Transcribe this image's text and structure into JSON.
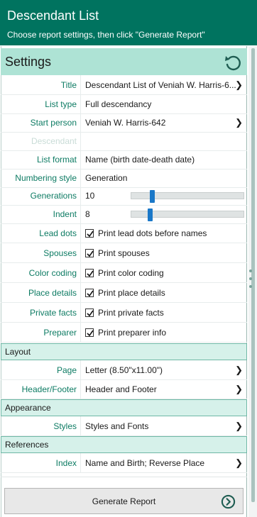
{
  "header": {
    "title": "Descendant List",
    "subtitle": "Choose report settings, then click \"Generate Report\""
  },
  "settings": {
    "label": "Settings",
    "reset_icon": "reset-icon"
  },
  "rows": {
    "title": {
      "label": "Title",
      "value": "Descendant List of Veniah W. Harris-6..."
    },
    "list_type": {
      "label": "List type",
      "value": "Full descendancy"
    },
    "start_person": {
      "label": "Start person",
      "value": "Veniah W. Harris-642"
    },
    "descendant": {
      "label": "Descendant",
      "value": ""
    },
    "list_format": {
      "label": "List format",
      "value": "Name (birth date-death date)"
    },
    "numbering_style": {
      "label": "Numbering style",
      "value": "Generation"
    },
    "generations": {
      "label": "Generations",
      "value": "10",
      "slider_fraction": 0.17
    },
    "indent": {
      "label": "Indent",
      "value": "8",
      "slider_fraction": 0.15
    },
    "lead_dots": {
      "label": "Lead dots",
      "value": "Print lead dots before names",
      "checked": true
    },
    "spouses": {
      "label": "Spouses",
      "value": "Print spouses",
      "checked": true
    },
    "color_coding": {
      "label": "Color coding",
      "value": "Print color coding",
      "checked": true
    },
    "place_details": {
      "label": "Place details",
      "value": "Print place details",
      "checked": true
    },
    "private_facts": {
      "label": "Private facts",
      "value": "Print private facts",
      "checked": true
    },
    "preparer": {
      "label": "Preparer",
      "value": "Print preparer info",
      "checked": true
    }
  },
  "layout": {
    "section_label": "Layout",
    "page": {
      "label": "Page",
      "value": "Letter (8.50\"x11.00\")"
    },
    "header_footer": {
      "label": "Header/Footer",
      "value": "Header and Footer"
    }
  },
  "appearance": {
    "section_label": "Appearance",
    "styles": {
      "label": "Styles",
      "value": "Styles and Fonts"
    }
  },
  "references": {
    "section_label": "References",
    "index": {
      "label": "Index",
      "value": "Name and Birth; Reverse Place"
    }
  },
  "footer": {
    "generate_label": "Generate Report",
    "go_icon": "arrow-right-circle-icon"
  },
  "colors": {
    "brand": "#00735f",
    "label_text": "#0d7b63",
    "settings_bar": "#aee3d5",
    "section_bg": "#d6f1ea",
    "slider_thumb": "#1a78c8"
  }
}
